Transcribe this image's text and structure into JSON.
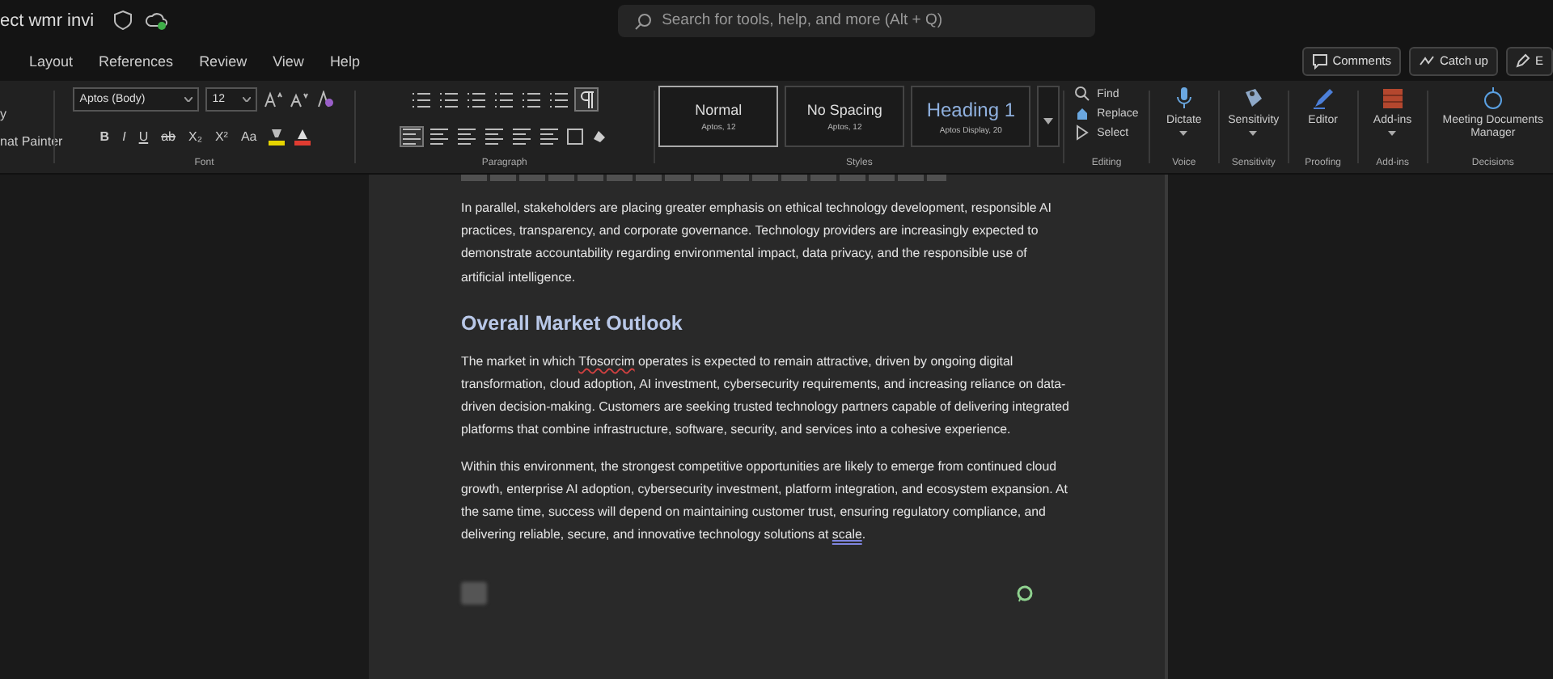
{
  "window": {
    "title": "ect wmr invi"
  },
  "search": {
    "placeholder": "Search for tools, help, and more (Alt + Q)"
  },
  "tabs": [
    "Layout",
    "References",
    "Review",
    "View",
    "Help"
  ],
  "header_buttons": [
    {
      "kind": "comments",
      "label": "Comments"
    },
    {
      "kind": "catchup",
      "label": "Catch up"
    },
    {
      "kind": "edit",
      "label": "E"
    }
  ],
  "clipboard": {
    "items": [
      "y",
      "nat Painter"
    ]
  },
  "font": {
    "name": "Aptos (Body)",
    "size": "12",
    "format_buttons": [
      "B",
      "I",
      "U",
      "ab",
      "X₂",
      "X²",
      "Aa"
    ],
    "label": "Font"
  },
  "paragraph": {
    "label": "Paragraph",
    "show_marks": true
  },
  "styles": {
    "label": "Styles",
    "items": [
      {
        "name": "Normal",
        "detail": "Aptos, 12",
        "kind": "normal",
        "selected": true
      },
      {
        "name": "No Spacing",
        "detail": "Aptos, 12",
        "kind": "normal",
        "selected": false
      },
      {
        "name": "Heading 1",
        "detail": "Aptos Display, 20",
        "kind": "heading",
        "selected": false
      }
    ]
  },
  "editing": {
    "label": "Editing",
    "items": [
      {
        "kind": "find",
        "label": "Find"
      },
      {
        "kind": "replace",
        "label": "Replace"
      },
      {
        "kind": "select",
        "label": "Select"
      }
    ]
  },
  "groups": [
    {
      "kind": "dictate",
      "label": "Dictate",
      "group": "Voice",
      "dropdown": true
    },
    {
      "kind": "sensitivity",
      "label": "Sensitivity",
      "group": "Sensitivity",
      "dropdown": true
    },
    {
      "kind": "editor",
      "label": "Editor",
      "group": "Proofing",
      "dropdown": false
    },
    {
      "kind": "addins",
      "label": "Add-ins",
      "group": "Add-ins",
      "dropdown": true
    },
    {
      "kind": "meeting",
      "label": "Meeting Documents Manager",
      "group": "Decisions",
      "dropdown": false
    }
  ],
  "document": {
    "blocks": [
      {
        "kind": "paragraph",
        "runs": [
          {
            "text": "In parallel, stakeholders are placing greater emphasis on ethical technology development, responsible AI practices, transparency, and corporate governance. Technology providers are increasingly expected to demonstrate accountability regarding environmental impact, data privacy, and the responsible use of artificial intelligence."
          }
        ]
      },
      {
        "kind": "heading",
        "runs": [
          {
            "text": "Overall Market Outlook"
          }
        ]
      },
      {
        "kind": "paragraph",
        "runs": [
          {
            "text": "The market in which "
          },
          {
            "text": "Tfosorcim",
            "spelling_error": true
          },
          {
            "text": " operates is expected to remain attractive, driven by ongoing digital transformation, cloud adoption, AI investment, cybersecurity requirements, and increasing reliance on data-driven decision-making. Customers are seeking trusted technology partners capable of delivering integrated platforms that combine infrastructure, software, security, and services into a cohesive experience."
          }
        ]
      },
      {
        "kind": "paragraph",
        "runs": [
          {
            "text": "Within this environment, the strongest competitive opportunities are likely to emerge from continued cloud growth, enterprise AI adoption, cybersecurity investment, platform integration, and ecosystem expansion. At the same time, success will depend on maintaining customer trust, ensuring regulatory compliance, and delivering reliable, secure, and innovative technology solutions at "
          },
          {
            "text": "scale",
            "grammar_issue": true
          },
          {
            "text": "."
          }
        ]
      }
    ]
  }
}
